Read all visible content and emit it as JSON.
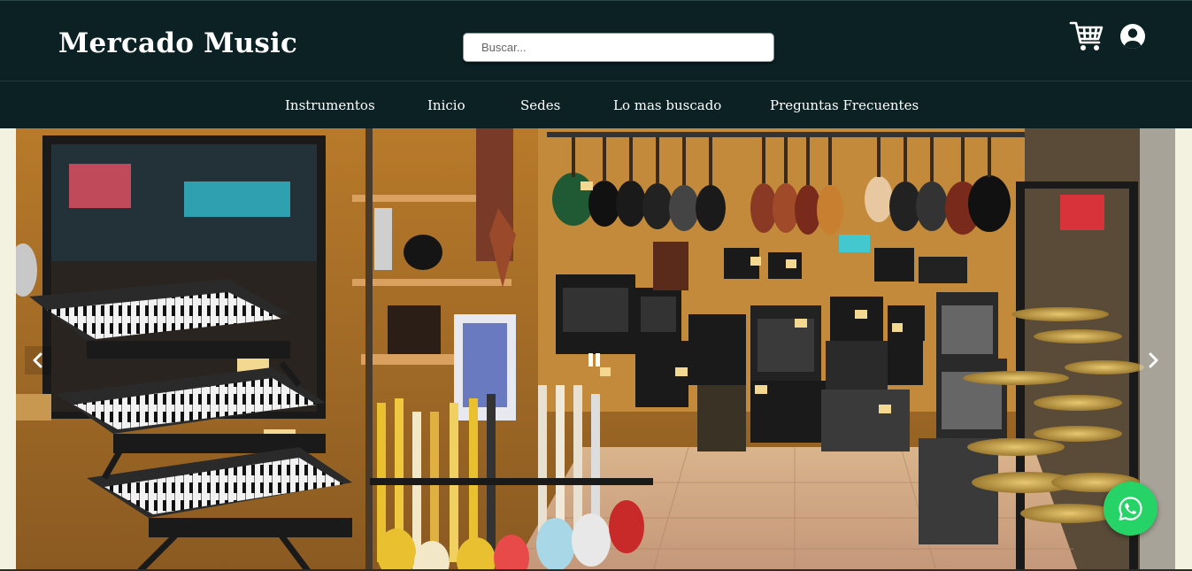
{
  "header": {
    "brand": "Mercado Music",
    "search": {
      "placeholder": "Buscar...",
      "value": ""
    },
    "icons": {
      "cart": "cart-icon",
      "account": "user-circle-icon"
    }
  },
  "nav": {
    "items": [
      {
        "label": "Instrumentos"
      },
      {
        "label": "Inicio"
      },
      {
        "label": "Sedes"
      },
      {
        "label": "Lo mas buscado"
      },
      {
        "label": "Preguntas Frecuentes"
      }
    ]
  },
  "carousel": {
    "slide": {
      "description": "music-store-interior-photo"
    },
    "controls": {
      "prev": "chevron-left-icon",
      "next": "chevron-right-icon",
      "pause": "pause-icon"
    }
  },
  "floating": {
    "whatsapp": "whatsapp-icon",
    "color": "#25d366"
  },
  "colors": {
    "header_bg": "#0b2124",
    "page_bg": "#f3f1df",
    "text_light": "#ffffff"
  }
}
